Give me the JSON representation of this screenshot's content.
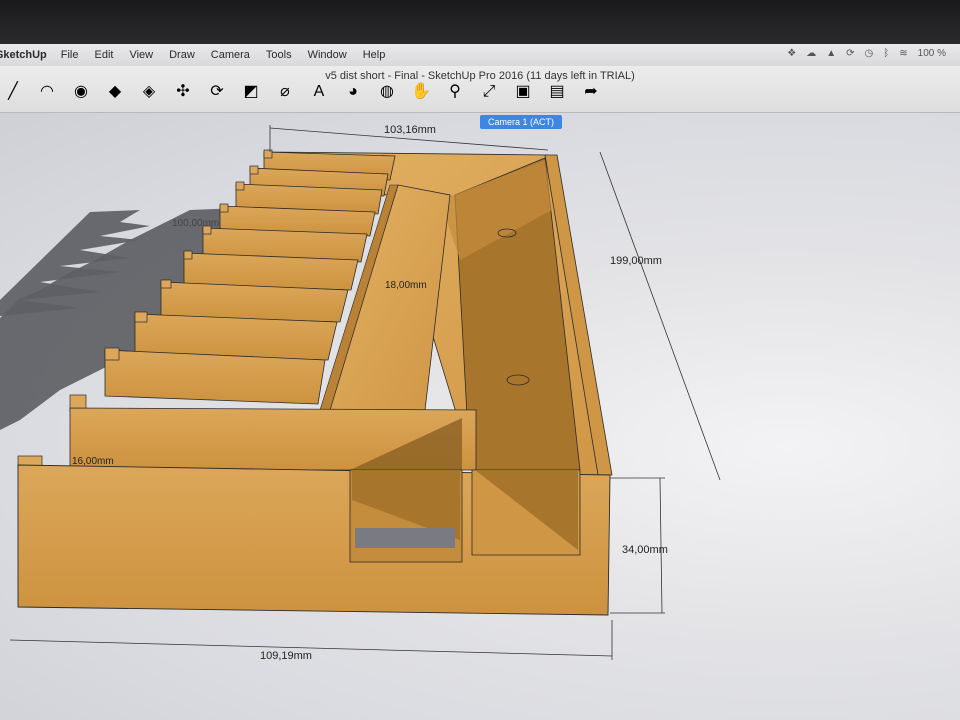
{
  "app": {
    "name": "SketchUp",
    "title": "v5 dist short - Final - SketchUp Pro 2016 (11 days left in TRIAL)",
    "menus": [
      "File",
      "Edit",
      "View",
      "Draw",
      "Camera",
      "Tools",
      "Window",
      "Help"
    ],
    "battery": "100 %"
  },
  "toolbar": {
    "tools": [
      {
        "name": "line-tool",
        "glyph": "╱"
      },
      {
        "name": "arc-tool",
        "glyph": "◠"
      },
      {
        "name": "shape-tool",
        "glyph": "◉"
      },
      {
        "name": "push-pull-tool",
        "glyph": "◆"
      },
      {
        "name": "follow-me-tool",
        "glyph": "◈"
      },
      {
        "name": "move-tool",
        "glyph": "✣"
      },
      {
        "name": "rotate-tool",
        "glyph": "⟳"
      },
      {
        "name": "scale-tool",
        "glyph": "◩"
      },
      {
        "name": "tape-measure-tool",
        "glyph": "⌀"
      },
      {
        "name": "text-tool",
        "glyph": "A"
      },
      {
        "name": "paint-bucket-tool",
        "glyph": "◕"
      },
      {
        "name": "orbit-tool",
        "glyph": "◍"
      },
      {
        "name": "pan-tool",
        "glyph": "✋"
      },
      {
        "name": "zoom-tool",
        "glyph": "⚲"
      },
      {
        "name": "zoom-extents-tool",
        "glyph": "⤢"
      },
      {
        "name": "warehouse-tool",
        "glyph": "▣"
      },
      {
        "name": "extension-tool",
        "glyph": "▤"
      },
      {
        "name": "share-tool",
        "glyph": "➦"
      }
    ]
  },
  "scene": {
    "camera_tag": "Camera 1 (ACT)",
    "dimensions": {
      "top": "103,16mm",
      "right": "199,00mm",
      "height": "34,00mm",
      "bottom": "109,19mm",
      "inner": "18,00mm",
      "left": "16,00mm",
      "shadow": "100,00mm"
    },
    "colors": {
      "wood": "#d9a34f",
      "wood_dark": "#a8752c",
      "wood_shadow": "#8f6426",
      "shadow": "#5e5f64",
      "accent": "#3d86e1"
    }
  }
}
